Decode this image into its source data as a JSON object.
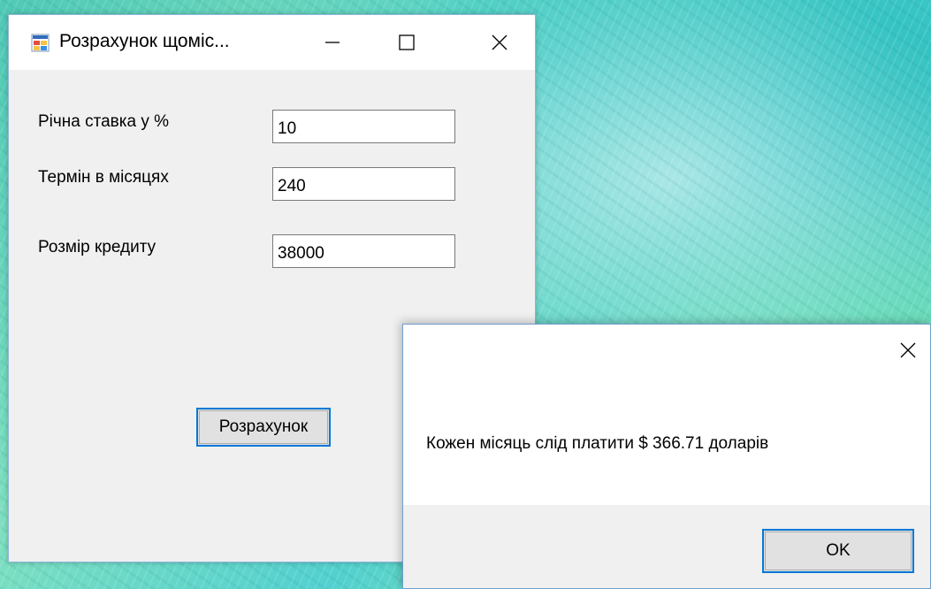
{
  "main_window": {
    "title": "Розрахунок щоміс...",
    "icon": "app-form-icon",
    "controls": {
      "minimize_icon": "minimize-icon",
      "maximize_icon": "maximize-icon",
      "close_icon": "close-icon"
    },
    "fields": [
      {
        "label": "Річна ставка у %",
        "value": "10"
      },
      {
        "label": "Термін в місяцях",
        "value": "240"
      },
      {
        "label": "Розмір кредиту",
        "value": "38000"
      }
    ],
    "calculate_label": "Розрахунок"
  },
  "message_box": {
    "text": "Кожен місяць слід платити $ 366.71 доларів",
    "ok_label": "OK",
    "close_icon": "close-icon"
  },
  "colors": {
    "accent": "#0078d7",
    "window_bg": "#f0f0f0",
    "titlebar_bg": "#ffffff",
    "button_bg": "#e1e1e1"
  }
}
